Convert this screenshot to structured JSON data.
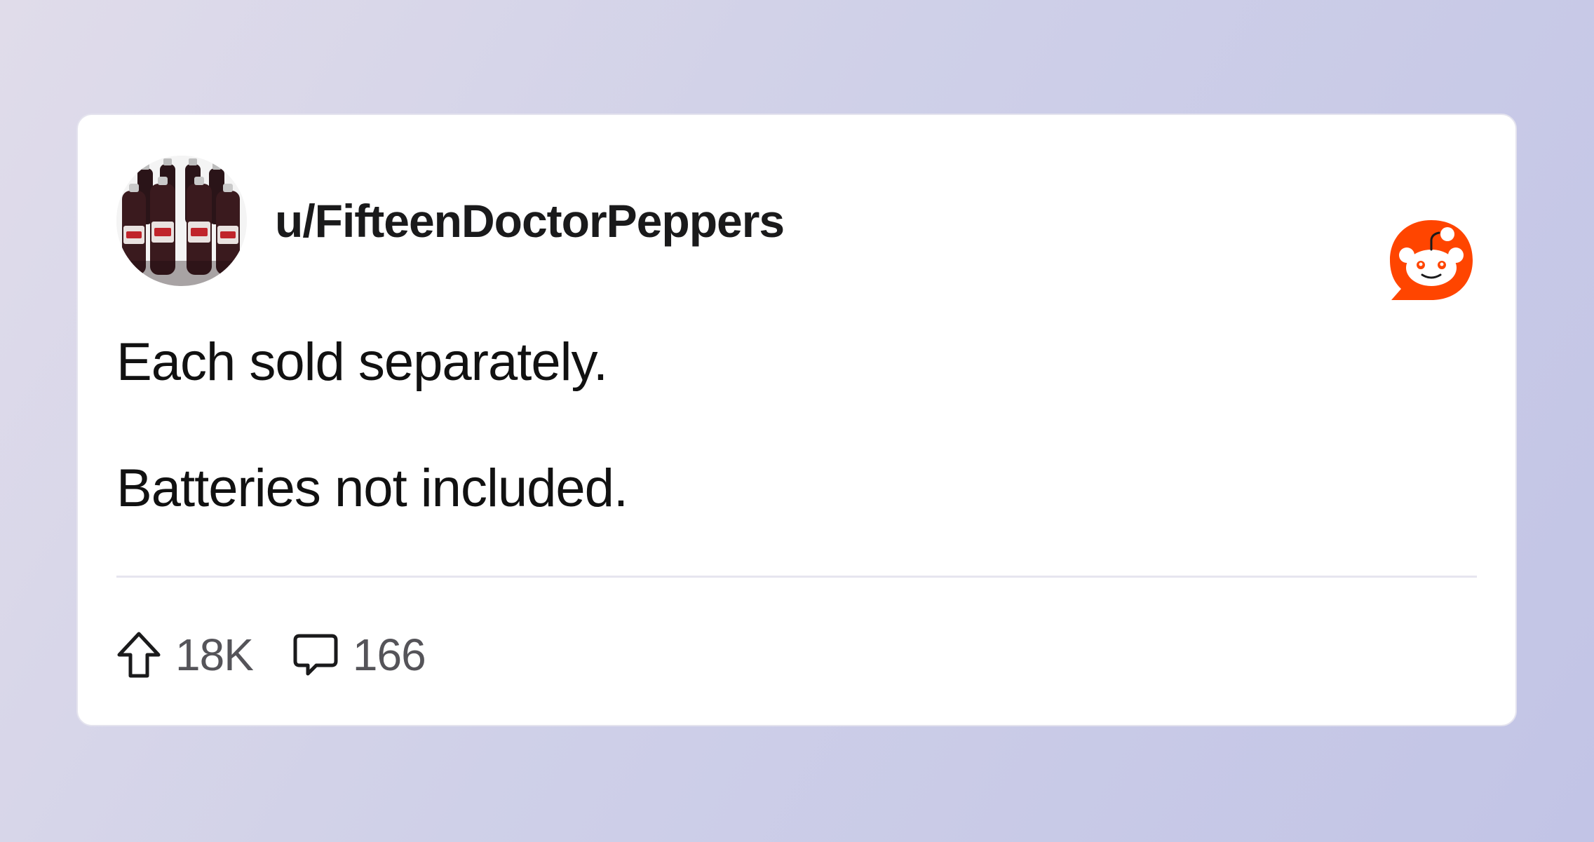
{
  "post": {
    "username": "u/FifteenDoctorPeppers",
    "body_lines": [
      "Each sold separately.",
      "Batteries not included."
    ],
    "upvotes": "18K",
    "comments": "166"
  },
  "icons": {
    "avatar": "avatar",
    "brand": "reddit-logo-icon",
    "upvote": "upvote-arrow-icon",
    "comment": "comment-bubble-icon"
  },
  "colors": {
    "brand": "#ff4500",
    "text_primary": "#1a1a1b",
    "text_secondary": "#555459",
    "divider": "#e6e5ef"
  }
}
